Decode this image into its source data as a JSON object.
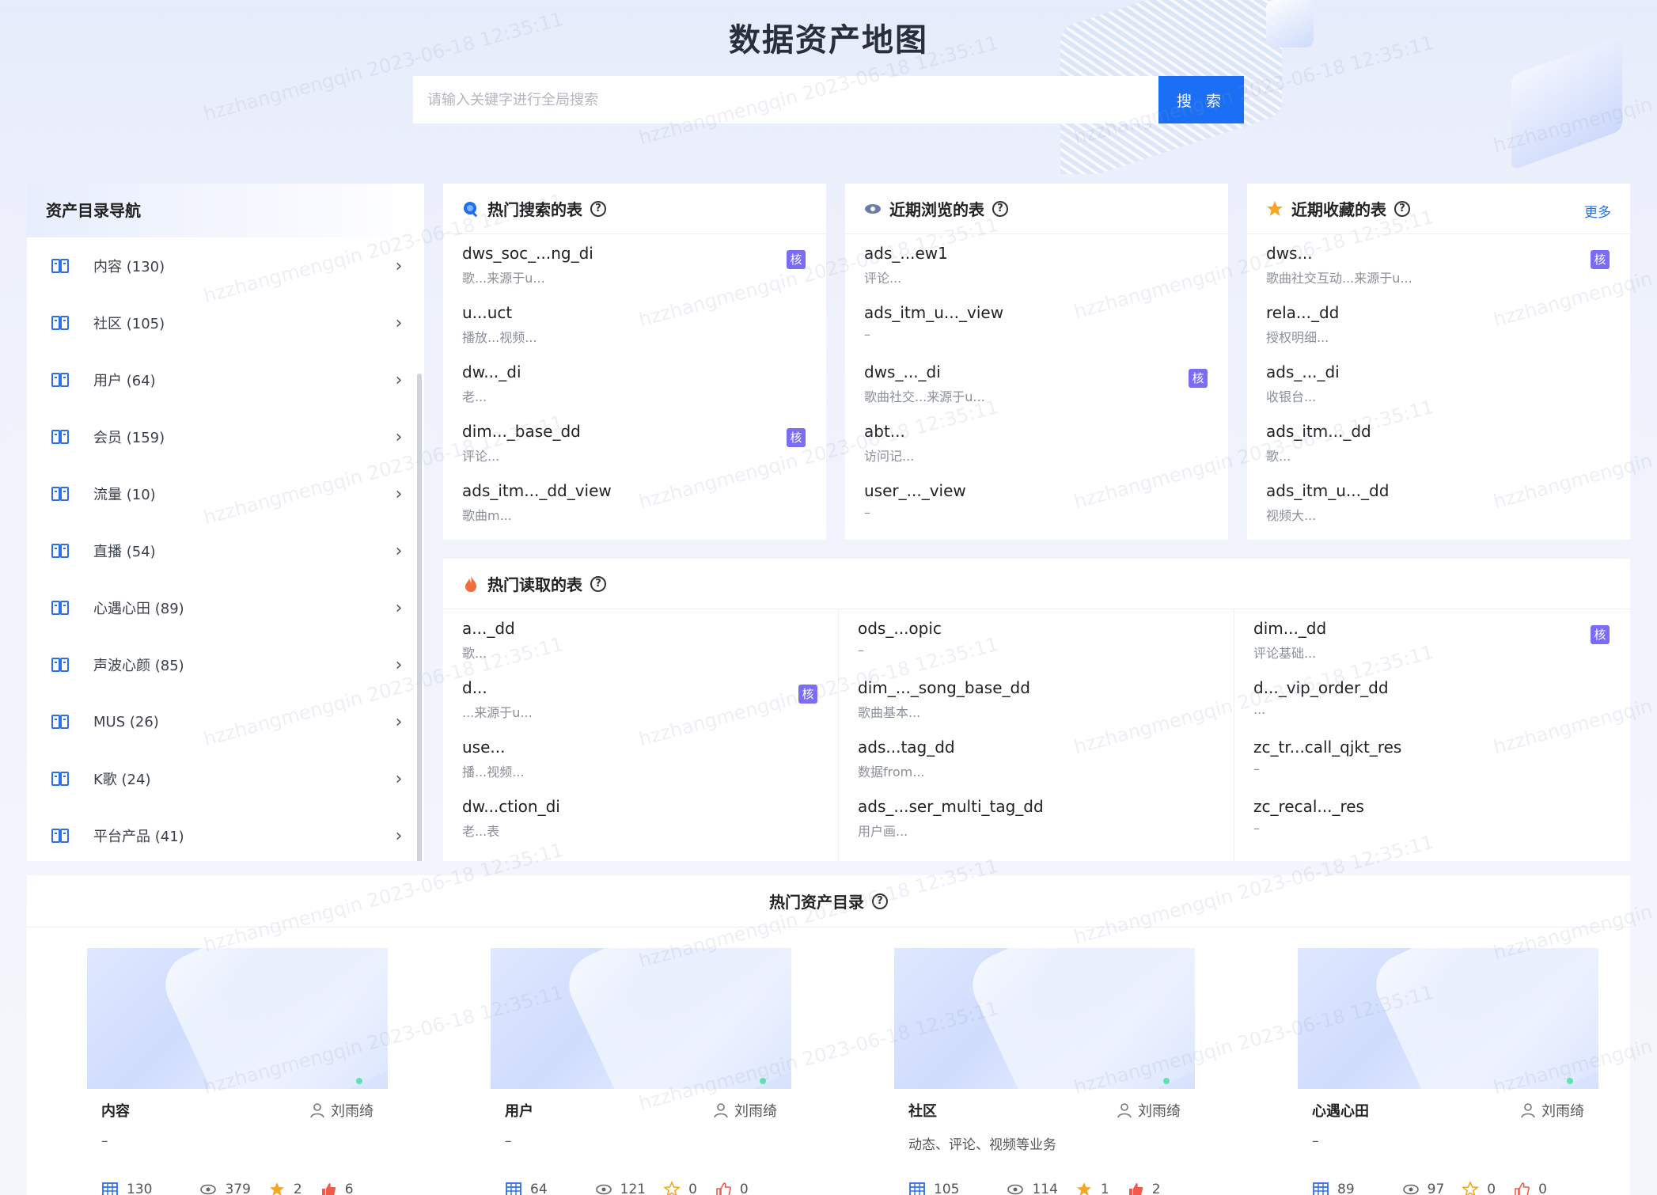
{
  "header": {
    "title": "数据资产地图",
    "search_placeholder": "请输入关键字进行全局搜索",
    "search_button": "搜 索"
  },
  "nav": {
    "title": "资产目录导航",
    "items": [
      {
        "label": "内容 (130)"
      },
      {
        "label": "社区 (105)"
      },
      {
        "label": "用户 (64)"
      },
      {
        "label": "会员 (159)"
      },
      {
        "label": "流量 (10)"
      },
      {
        "label": "直播 (54)"
      },
      {
        "label": "心遇心田 (89)"
      },
      {
        "label": "声波心颜 (85)"
      },
      {
        "label": "MUS (26)"
      },
      {
        "label": "K歌 (24)"
      },
      {
        "label": "平台产品 (41)"
      }
    ]
  },
  "hot_search": {
    "title": "热门搜索的表",
    "core_tag": "核",
    "items": [
      {
        "name": "dws_soc_...ng_di",
        "desc": "歌...来源于u..."
      },
      {
        "name": "u...uct",
        "desc": "播放...视频..."
      },
      {
        "name": "dw..._di",
        "desc": "老..."
      },
      {
        "name": "dim..._base_dd",
        "desc": "评论..."
      },
      {
        "name": "ads_itm..._dd_view",
        "desc": "歌曲m..."
      }
    ]
  },
  "recent_view": {
    "title": "近期浏览的表",
    "items": [
      {
        "name": "ads_...ew1",
        "desc": "评论..."
      },
      {
        "name": "ads_itm_u..._view",
        "desc": "–"
      },
      {
        "name": "dws_..._di",
        "desc": "歌曲社交...来源于u..."
      },
      {
        "name": "abt...",
        "desc": "访问记..."
      },
      {
        "name": "user_..._view",
        "desc": "–"
      }
    ]
  },
  "recent_fav": {
    "title": "近期收藏的表",
    "more": "更多",
    "items": [
      {
        "name": "dws...",
        "desc": "歌曲社交互动...来源于u..."
      },
      {
        "name": "rela..._dd",
        "desc": "授权明细..."
      },
      {
        "name": "ads_..._di",
        "desc": "收银台..."
      },
      {
        "name": "ads_itm..._dd",
        "desc": "歌..."
      },
      {
        "name": "ads_itm_u..._dd",
        "desc": "视频大..."
      }
    ]
  },
  "hot_read": {
    "title": "热门读取的表",
    "col1": [
      {
        "name": "a..._dd",
        "desc": "歌..."
      },
      {
        "name": "d...",
        "desc": "...来源于u..."
      },
      {
        "name": "use...",
        "desc": "播...视频..."
      },
      {
        "name": "dw...ction_di",
        "desc": "老...表"
      }
    ],
    "col2": [
      {
        "name": "ods_...opic",
        "desc": "–"
      },
      {
        "name": "dim_..._song_base_dd",
        "desc": "歌曲基本..."
      },
      {
        "name": "ads...tag_dd",
        "desc": "数据from..."
      },
      {
        "name": "ads_...ser_multi_tag_dd",
        "desc": "用户画..."
      }
    ],
    "col3": [
      {
        "name": "dim..._dd",
        "desc": "评论基础..."
      },
      {
        "name": "d..._vip_order_dd",
        "desc": "..."
      },
      {
        "name": "zc_tr...call_qjkt_res",
        "desc": "–"
      },
      {
        "name": "zc_recal..._res",
        "desc": "–"
      }
    ]
  },
  "hot_catalog": {
    "title": "热门资产目录",
    "cards": [
      {
        "name": "内容",
        "owner": "刘雨绮",
        "desc": "–",
        "tables": "130",
        "views": "379",
        "stars": "2",
        "likes": "6"
      },
      {
        "name": "用户",
        "owner": "刘雨绮",
        "desc": "–",
        "tables": "64",
        "views": "121",
        "stars": "0",
        "likes": "0"
      },
      {
        "name": "社区",
        "owner": "刘雨绮",
        "desc": "动态、评论、视频等业务",
        "tables": "105",
        "views": "114",
        "stars": "1",
        "likes": "2"
      },
      {
        "name": "心遇心田",
        "owner": "刘雨绮",
        "desc": "–",
        "tables": "89",
        "views": "97",
        "stars": "0",
        "likes": "0"
      }
    ]
  },
  "watermark": "hzzhangmengqin 2023-06-18 12:35:11",
  "colors": {
    "accent": "#1a6ff5",
    "core_tag": "#7b6cf6",
    "star": "#f5a623",
    "like": "#ef5a4b"
  }
}
